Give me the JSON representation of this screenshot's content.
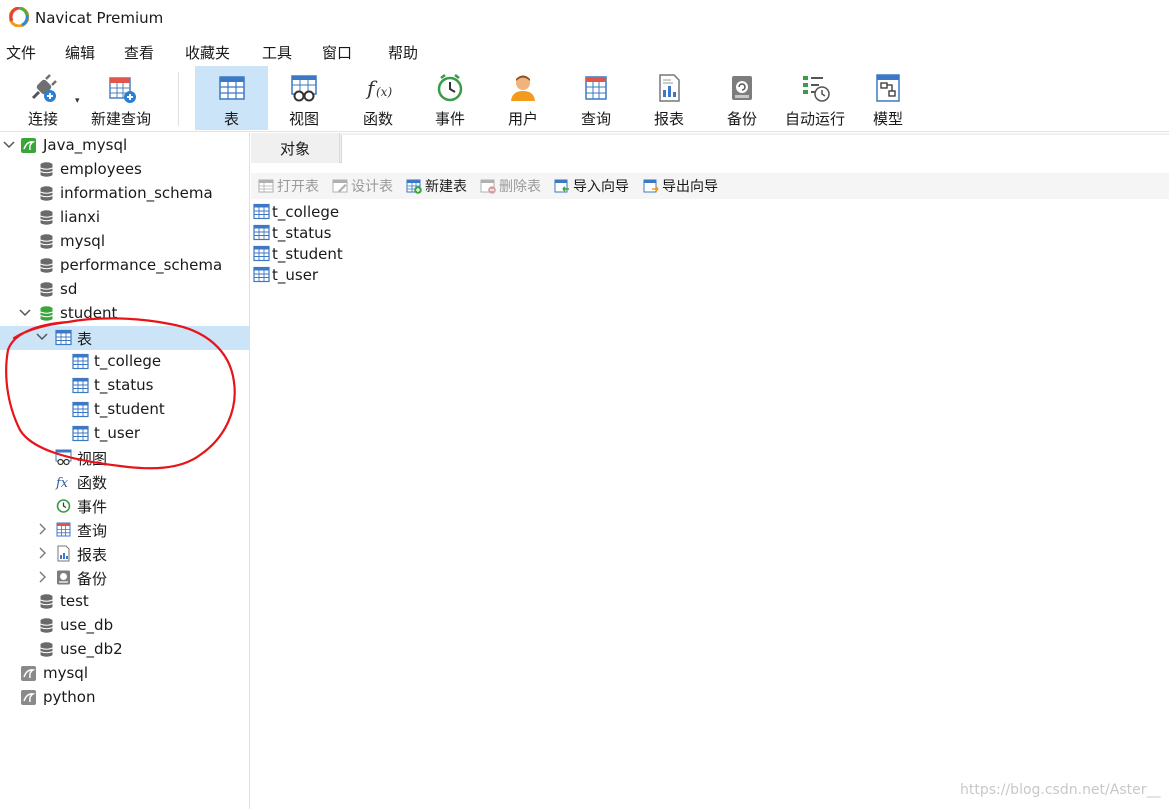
{
  "window": {
    "title": "Navicat Premium"
  },
  "menu": [
    "文件",
    "编辑",
    "查看",
    "收藏夹",
    "工具",
    "窗口",
    "帮助"
  ],
  "toolbar": {
    "connect": "连接",
    "new_query": "新建查询",
    "table": "表",
    "view": "视图",
    "function": "函数",
    "event": "事件",
    "user": "用户",
    "query": "查询",
    "report": "报表",
    "backup": "备份",
    "auto_run": "自动运行",
    "model": "模型"
  },
  "tree": {
    "connection": "Java_mysql",
    "databases": [
      "employees",
      "information_schema",
      "lianxi",
      "mysql",
      "performance_schema",
      "sd"
    ],
    "open_db": "student",
    "tables_node": "表",
    "tables": [
      "t_college",
      "t_status",
      "t_student",
      "t_user"
    ],
    "views_node": "视图",
    "functions_node": "函数",
    "events_node": "事件",
    "queries_node": "查询",
    "reports_node": "报表",
    "backups_node": "备份",
    "databases_after": [
      "test",
      "use_db",
      "use_db2"
    ],
    "other_connections": [
      "mysql",
      "python"
    ]
  },
  "main": {
    "tab": "对象",
    "actions": {
      "open_table": "打开表",
      "design_table": "设计表",
      "new_table": "新建表",
      "delete_table": "删除表",
      "import_wizard": "导入向导",
      "export_wizard": "导出向导"
    },
    "objects": [
      "t_college",
      "t_status",
      "t_student",
      "t_user"
    ]
  },
  "watermark": "https://blog.csdn.net/Aster__",
  "colors": {
    "selection": "#cce4f7",
    "annotation": "#e8141a",
    "db_active": "#3aa63a"
  }
}
